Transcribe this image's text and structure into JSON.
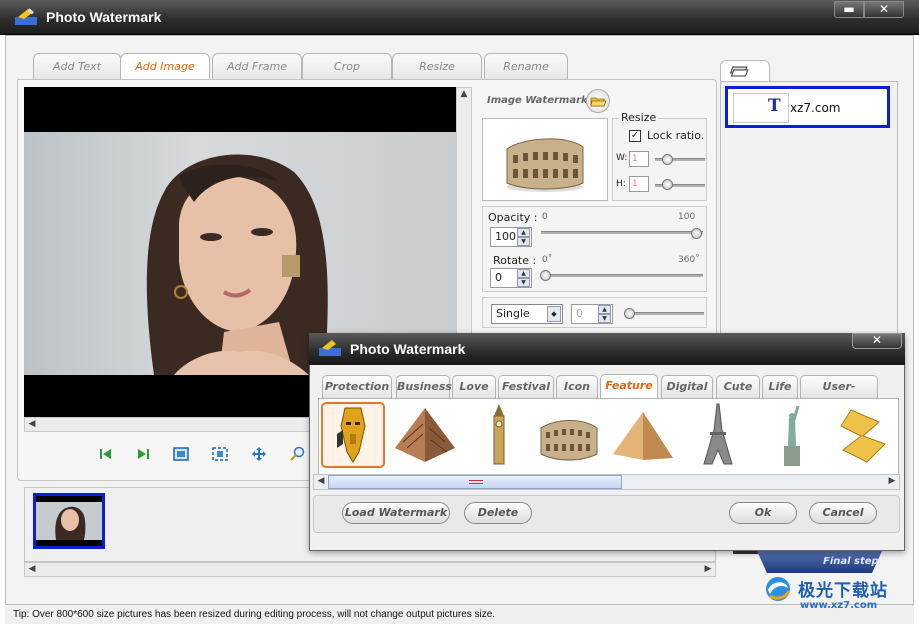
{
  "window": {
    "title": "Photo Watermark",
    "min_label": "▬",
    "close_label": "✕"
  },
  "tabs": [
    {
      "label": "Add Text"
    },
    {
      "label": "Add Image"
    },
    {
      "label": "Add Frame"
    },
    {
      "label": "Crop"
    },
    {
      "label": "Resize"
    },
    {
      "label": "Rename"
    }
  ],
  "image_watermark": {
    "label": "Image Watermark",
    "resize_label": "Resize",
    "lock_ratio_label": "Lock ratio.",
    "lock_ratio_checked": true,
    "w_label": "W:",
    "h_label": "H:",
    "w_value": "1",
    "h_value": "1",
    "opacity_label": "Opacity :",
    "opacity_min": "0",
    "opacity_max": "100",
    "opacity_value": "100",
    "rotate_label": "Rotate :",
    "rotate_min": "0˚",
    "rotate_max": "360˚",
    "rotate_value": "0",
    "mode_value": "Single",
    "mode_count": "0"
  },
  "text_list": {
    "items": [
      {
        "text": "xz7.com",
        "icon": "T"
      }
    ]
  },
  "final_step_label": "Final step",
  "status": "Tip: Over 800*600 size pictures has been resized during editing process, will not change output pictures size.",
  "dialog": {
    "title": "Photo Watermark",
    "close_label": "✕",
    "categories": [
      {
        "label": "Protection"
      },
      {
        "label": "Business"
      },
      {
        "label": "Love"
      },
      {
        "label": "Festival"
      },
      {
        "label": "Icon"
      },
      {
        "label": "Feature"
      },
      {
        "label": "Digital"
      },
      {
        "label": "Cute"
      },
      {
        "label": "Life"
      },
      {
        "label": "User-defined"
      }
    ],
    "active_category": "Feature",
    "buttons": {
      "load": "Load Watermark",
      "delete": "Delete",
      "ok": "Ok",
      "cancel": "Cancel"
    }
  },
  "site_watermark": {
    "cn": "极光下载站",
    "url": "www.xz7.com"
  }
}
